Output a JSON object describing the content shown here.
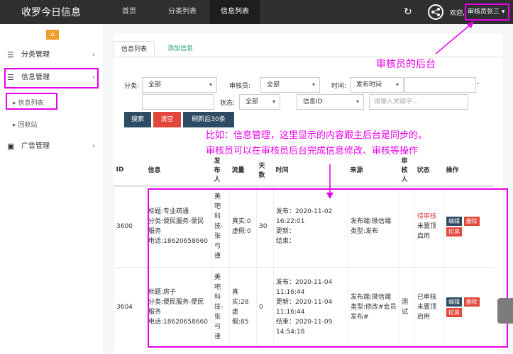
{
  "topbar": {
    "brand": "收罗今日信息",
    "nav": [
      "首页",
      "分类列表",
      "信息列表"
    ],
    "welcome": "欢迎,",
    "user": "审核员张三"
  },
  "sidebar": {
    "items": [
      {
        "label": "分类管理",
        "icon": "list-icon"
      },
      {
        "label": "信息管理",
        "icon": "list-icon"
      },
      {
        "label": "广告管理",
        "icon": "image-icon"
      }
    ],
    "subitems": [
      "信息列表",
      "回收站"
    ]
  },
  "tabs": {
    "list": "信息列表",
    "add": "添加信息"
  },
  "filters": {
    "category_label": "分类:",
    "category_value": "全部",
    "reviewer_label": "审核员:",
    "reviewer_value": "全部",
    "time_label": "时间:",
    "time_value": "发布时间",
    "dash": "-",
    "status_label": "状态:",
    "status_value": "全部",
    "field_value": "信息ID",
    "keyword_placeholder": "请输入关键字..."
  },
  "buttons": {
    "search": "搜索",
    "clear": "清空",
    "refresh": "刷新后30条"
  },
  "annotations": {
    "reviewer_backend": "审核员的后台",
    "line1": "比如：信息管理，这里显示的内容跟主后台是同步的。",
    "line2": "审核员可以在审核员后台完成信息修改、审核等操作"
  },
  "table": {
    "headers": [
      "ID",
      "信息",
      "发布人",
      "流量",
      "天数",
      "时间",
      "来源",
      "审核人",
      "状态",
      "操作"
    ],
    "rows": [
      {
        "id": "3600",
        "info": [
          "标题:专业疏通",
          "分类:便民服务-便民服务",
          "电话:18620658660"
        ],
        "publisher": "美吧科技-张弓谨",
        "flow": [
          "真实:0",
          "虚假:0"
        ],
        "days": "30",
        "time": [
          "发布：2020-11-02 16:22:01",
          "更新：",
          "结束："
        ],
        "source": [
          "发布端:微信端",
          "类型:发布"
        ],
        "reviewer": "",
        "status": [
          "待审核",
          "未置顶",
          "启用"
        ],
        "ops": [
          "编辑",
          "删除",
          "拉黑"
        ]
      },
      {
        "id": "3604",
        "info": [
          "标题:房子",
          "分类:便民服务-便民服务",
          "电话:18620658660"
        ],
        "publisher": "美吧科技-张弓谨",
        "flow": [
          "真实:28",
          "虚假:85"
        ],
        "days": "0",
        "time": [
          "发布：2020-11-04 11:16:44",
          "更新：2020-11-04 11:16:44",
          "结束：2020-11-09 14:54:18"
        ],
        "source": [
          "发布端:微信端",
          "类型:修改#会员发布#"
        ],
        "reviewer": "测试",
        "status": [
          "已审核",
          "未置顶",
          "启用"
        ],
        "ops": [
          "编辑",
          "删除",
          "拉黑"
        ]
      }
    ]
  },
  "colors": {
    "topbar": "#2d2f31",
    "highlight": "#e800e8",
    "search_btn": "#2d4b63",
    "clear_btn": "#e3463b",
    "pending": "#e03a3a"
  }
}
